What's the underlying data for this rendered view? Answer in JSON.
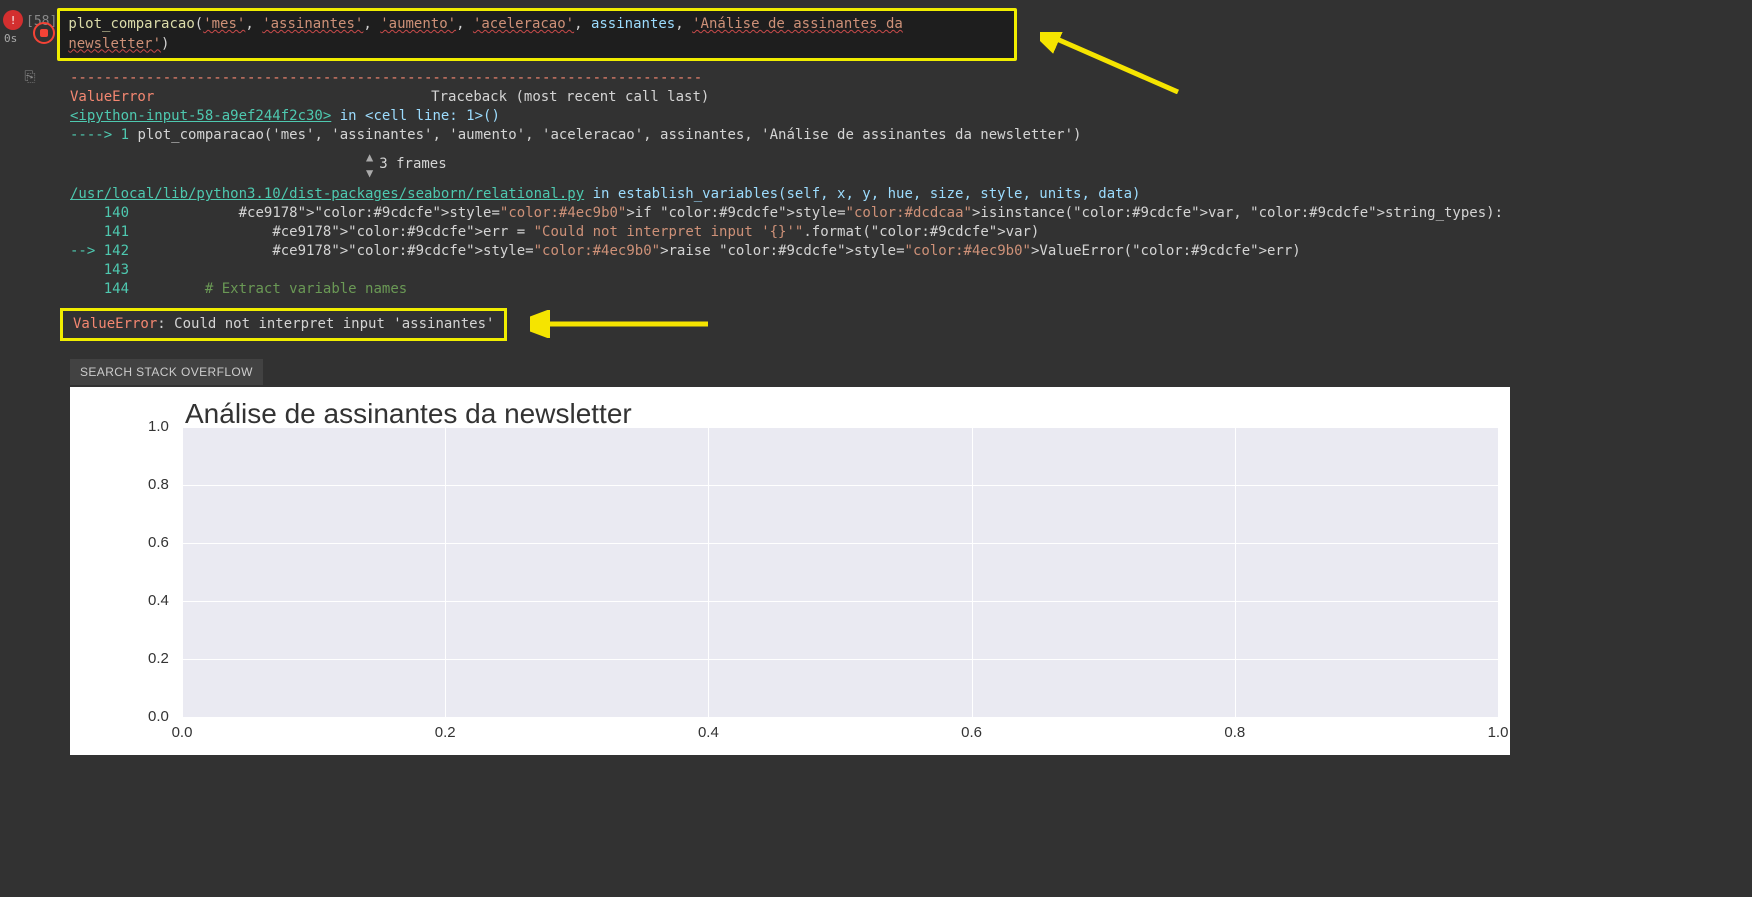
{
  "cell": {
    "number_label": "[58]",
    "exec_time": "0s",
    "code_tokens": [
      {
        "t": "plot_comparacao",
        "c": "fn"
      },
      {
        "t": "(",
        "c": "punct"
      },
      {
        "t": "'mes'",
        "c": "str"
      },
      {
        "t": ", ",
        "c": "punct"
      },
      {
        "t": "'assinantes'",
        "c": "str"
      },
      {
        "t": ", ",
        "c": "punct"
      },
      {
        "t": "'aumento'",
        "c": "str"
      },
      {
        "t": ", ",
        "c": "punct"
      },
      {
        "t": "'aceleracao'",
        "c": "str"
      },
      {
        "t": ", ",
        "c": "punct"
      },
      {
        "t": "assinantes",
        "c": "var"
      },
      {
        "t": ", ",
        "c": "punct"
      },
      {
        "t": "'Análise de assinantes da newsletter'",
        "c": "str"
      },
      {
        "t": ")",
        "c": "punct"
      }
    ]
  },
  "traceback": {
    "dashes": "---------------------------------------------------------------------------",
    "error_name": "ValueError",
    "traceback_label": "Traceback (most recent call last)",
    "link1": "<ipython-input-58-a9ef244f2c30>",
    "in_cell": " in <cell line: 1>()",
    "call_line_prefix": "----> 1 ",
    "call_line_code": "plot_comparacao('mes', 'assinantes', 'aumento', 'aceleracao', assinantes, 'Análise de assinantes da newsletter')",
    "frames_label": "3 frames",
    "link2": "/usr/local/lib/python3.10/dist-packages/seaborn/relational.py",
    "func_sig": " in establish_variables(self, x, y, hue, size, style, units, data)",
    "lines": [
      {
        "num": "    140",
        "code": "            if isinstance(var, string_types):"
      },
      {
        "num": "    141",
        "code": "                err = \"Could not interpret input '{}'\".format(var)"
      },
      {
        "num": "--> 142",
        "code": "                raise ValueError(err)"
      },
      {
        "num": "    143",
        "code": ""
      },
      {
        "num": "    144",
        "code": "        # Extract variable names"
      }
    ],
    "final_err_name": "ValueError",
    "final_err_msg": ": Could not interpret input 'assinantes'"
  },
  "so_button_label": "SEARCH STACK OVERFLOW",
  "chart_data": {
    "type": "line",
    "title": "Análise de assinantes da newsletter",
    "xlabel": "",
    "ylabel": "",
    "xlim": [
      0.0,
      1.0
    ],
    "ylim": [
      0.0,
      1.0
    ],
    "xticks": [
      "0.0",
      "0.2",
      "0.4",
      "0.6",
      "0.8",
      "1.0"
    ],
    "yticks": [
      "0.0",
      "0.2",
      "0.4",
      "0.6",
      "0.8",
      "1.0"
    ],
    "series": []
  }
}
